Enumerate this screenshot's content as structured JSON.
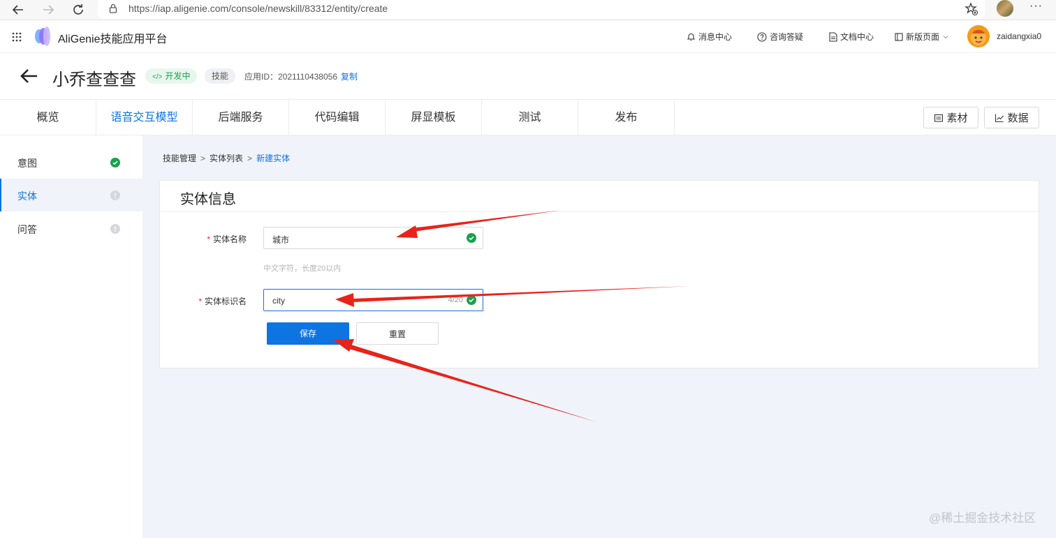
{
  "browser": {
    "url": "https://iap.aligenie.com/console/newskill/83312/entity/create",
    "back_icon": "arrow-left-icon",
    "forward_icon": "arrow-right-icon",
    "refresh_icon": "refresh-icon",
    "more_label": "···"
  },
  "header": {
    "app_title": "AliGenie技能应用平台",
    "nav": {
      "messages": "消息中心",
      "help": "咨询答疑",
      "docs": "文档中心",
      "new_page": "新版页面"
    },
    "username": "zaidangxia0"
  },
  "skill": {
    "name": "小乔查查查",
    "status": "开发中",
    "status_prefix": "</>",
    "type": "技能",
    "app_id_label": "应用ID：",
    "app_id": "2021110438056",
    "copy_label": "复制"
  },
  "tabs": [
    {
      "label": "概览"
    },
    {
      "label": "语音交互模型"
    },
    {
      "label": "后端服务"
    },
    {
      "label": "代码编辑"
    },
    {
      "label": "屏显模板"
    },
    {
      "label": "测试"
    },
    {
      "label": "发布"
    }
  ],
  "tab_buttons": {
    "materials": "素材",
    "data": "数据"
  },
  "sidebar": {
    "items": [
      {
        "label": "意图",
        "status": "done"
      },
      {
        "label": "实体",
        "status": "pending"
      },
      {
        "label": "问答",
        "status": "pending"
      }
    ]
  },
  "breadcrumb": {
    "items": [
      "技能管理",
      "实体列表",
      "新建实体"
    ],
    "separator": ">"
  },
  "form": {
    "card_title": "实体信息",
    "required_mark": "*",
    "entity_name_label": "实体名称",
    "entity_name_value": "城市",
    "entity_name_hint": "中文字符，长度20以内",
    "entity_id_label": "实体标识名",
    "entity_id_value": "city",
    "entity_id_count": "4/20",
    "save_label": "保存",
    "reset_label": "重置"
  },
  "watermark": "@稀土掘金技术社区",
  "colors": {
    "accent": "#0e74e2",
    "success": "#1aa14f",
    "annotation_arrow": "#e8231b",
    "main_bg": "#f0f3fa"
  }
}
